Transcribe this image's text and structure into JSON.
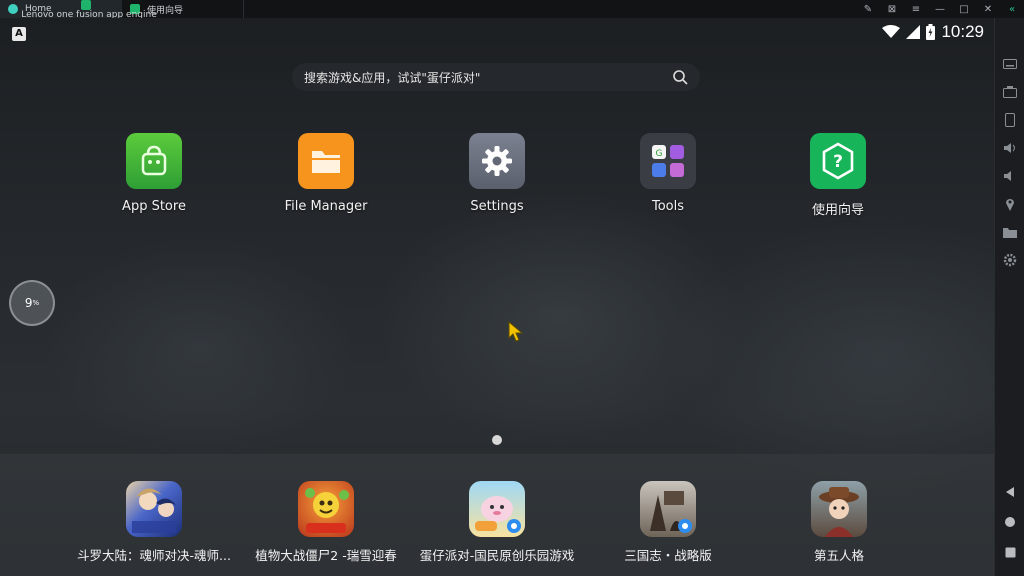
{
  "window": {
    "tabs": [
      {
        "label": "Lenovo one fusion app engine",
        "color": "#1fb36b"
      },
      {
        "label": "Home",
        "color": "#3fd0c0"
      },
      {
        "label": "使用向导",
        "color": "#1fb36b"
      }
    ]
  },
  "statusbar": {
    "indicator": "A",
    "time": "10:29"
  },
  "search": {
    "placeholder": "搜索游戏&应用，试试\"蛋仔派对\""
  },
  "desktop_apps": [
    {
      "label": "App Store",
      "icon": "app-store-icon",
      "color": "#3cb043"
    },
    {
      "label": "File Manager",
      "icon": "folder-icon",
      "color": "#f7941d"
    },
    {
      "label": "Settings",
      "icon": "gear-icon",
      "color": "#6b7280"
    },
    {
      "label": "Tools",
      "icon": "tools-folder-icon",
      "color": "#3a3d42"
    },
    {
      "label": "使用向导",
      "icon": "help-icon",
      "color": "#18b45a"
    }
  ],
  "float_ball": {
    "label": "9",
    "sup": "%"
  },
  "dock_apps": [
    {
      "label": "斗罗大陆：魂师对决-魂师...",
      "icon": "douluo-game-icon",
      "color": "#4a66c8"
    },
    {
      "label": "植物大战僵尸2 -瑞雪迎春",
      "icon": "pvz2-game-icon",
      "color": "#c8542a"
    },
    {
      "label": "蛋仔派对-国民原创乐园游戏",
      "icon": "eggy-party-game-icon",
      "color": "#f2c04a"
    },
    {
      "label": "三国志・战略版",
      "icon": "sanguozhi-game-icon",
      "color": "#8a8f96"
    },
    {
      "label": "第五人格",
      "icon": "identity-v-game-icon",
      "color": "#9b5a3a"
    }
  ],
  "sidebar": {
    "buttons": [
      "keyboard-icon",
      "screenshot-icon",
      "shake-icon",
      "volume-up-icon",
      "volume-down-icon",
      "location-icon",
      "folder-icon",
      "settings-icon",
      "back-icon",
      "home-icon",
      "recents-icon"
    ]
  }
}
